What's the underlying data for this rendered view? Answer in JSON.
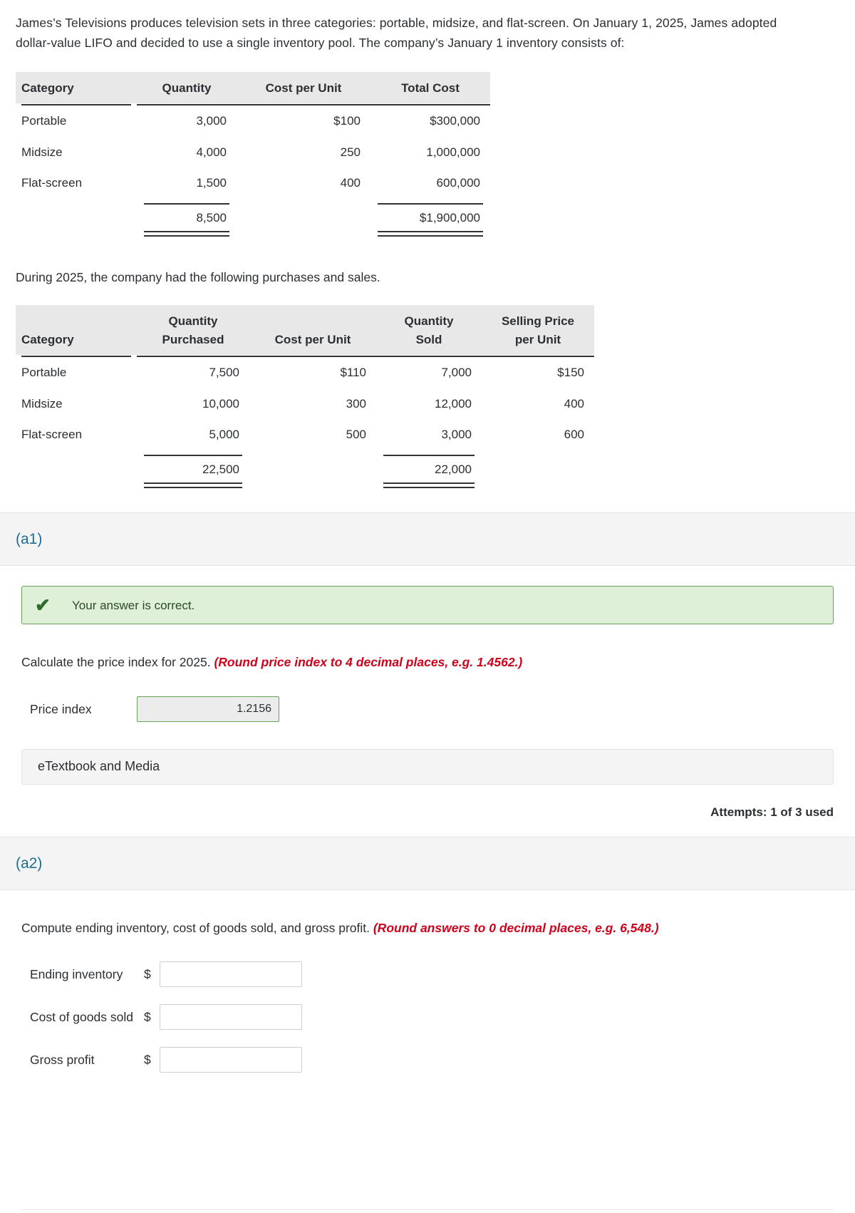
{
  "stem": {
    "paragraph": "James’s Televisions produces television sets in three categories: portable, midsize, and flat-screen. On January 1, 2025, James adopted dollar-value LIFO and decided to use a single inventory pool. The company’s January 1 inventory consists of:",
    "between": "During 2025, the company had the following purchases and sales."
  },
  "inventory_table": {
    "headers": [
      "Category",
      "Quantity",
      "Cost per Unit",
      "Total Cost"
    ],
    "rows": [
      {
        "category": "Portable",
        "quantity": "3,000",
        "cost_per_unit": "$100",
        "total_cost": "$300,000"
      },
      {
        "category": "Midsize",
        "quantity": "4,000",
        "cost_per_unit": "250",
        "total_cost": "1,000,000"
      },
      {
        "category": "Flat-screen",
        "quantity": "1,500",
        "cost_per_unit": "400",
        "total_cost": "600,000"
      }
    ],
    "totals": {
      "category": "",
      "quantity": "8,500",
      "cost_per_unit": "",
      "total_cost": "$1,900,000"
    }
  },
  "purchases_table": {
    "headers": [
      "Category",
      "Quantity Purchased",
      "Cost per Unit",
      "Quantity Sold",
      "Selling Price per Unit"
    ],
    "headers_lines": {
      "col1_top": "",
      "col1_bottom": "Category",
      "col2_top": "Quantity",
      "col2_bottom": "Purchased",
      "col3_top": "",
      "col3_bottom": "Cost per Unit",
      "col4_top": "Quantity",
      "col4_bottom": "Sold",
      "col5_top": "Selling Price",
      "col5_bottom": "per Unit"
    },
    "rows": [
      {
        "category": "Portable",
        "qty_purchased": "7,500",
        "cost_per_unit": "$110",
        "qty_sold": "7,000",
        "selling_price": "$150"
      },
      {
        "category": "Midsize",
        "qty_purchased": "10,000",
        "cost_per_unit": "300",
        "qty_sold": "12,000",
        "selling_price": "400"
      },
      {
        "category": "Flat-screen",
        "qty_purchased": "5,000",
        "cost_per_unit": "500",
        "qty_sold": "3,000",
        "selling_price": "600"
      }
    ],
    "totals": {
      "category": "",
      "qty_purchased": "22,500",
      "cost_per_unit": "",
      "qty_sold": "22,000",
      "selling_price": ""
    }
  },
  "part_a1": {
    "label": "(a1)",
    "banner": {
      "icon": "check-icon",
      "message": "Your answer is correct."
    },
    "prompt_main": "Calculate the price index for 2025. ",
    "prompt_hint": "(Round price index to 4 decimal places, e.g. 1.4562.)",
    "field": {
      "label": "Price index",
      "value": "1.2156",
      "placeholder": ""
    },
    "etextbook_label": "eTextbook and Media",
    "attempts": "Attempts: 1 of 3 used"
  },
  "part_a2": {
    "label": "(a2)",
    "prompt_main": "Compute ending inventory, cost of goods sold, and gross profit. ",
    "prompt_hint": "(Round answers to 0 decimal places, e.g. 6,548.)",
    "fields": [
      {
        "label": "Ending inventory",
        "currency": "$",
        "value": "",
        "placeholder": ""
      },
      {
        "label": "Cost of goods sold",
        "currency": "$",
        "value": "",
        "placeholder": ""
      },
      {
        "label": "Gross profit",
        "currency": "$",
        "value": "",
        "placeholder": ""
      }
    ]
  },
  "colors": {
    "part_label": "#1c6e8c",
    "hint_red": "#d0021b",
    "banner_bg": "#dff0d8",
    "banner_border": "#6a9e5a",
    "table_header_bg": "#e8e8e8"
  }
}
